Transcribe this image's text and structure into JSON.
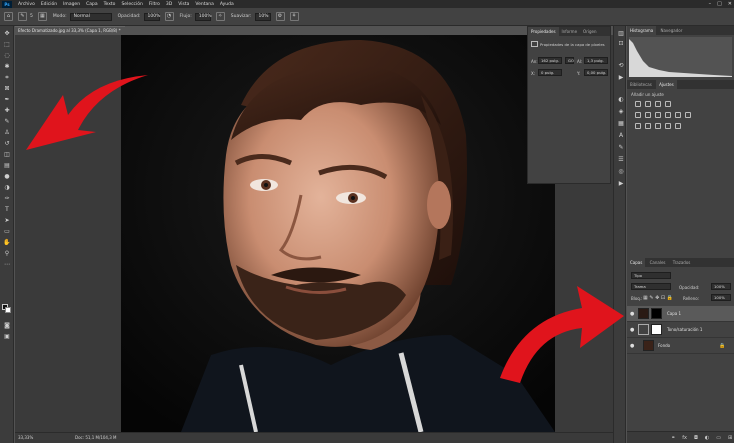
{
  "menubar": {
    "logo": "Ps",
    "items": [
      "Archivo",
      "Edición",
      "Imagen",
      "Capa",
      "Texto",
      "Selección",
      "Filtro",
      "3D",
      "Vista",
      "Ventana",
      "Ayuda"
    ],
    "window_controls": [
      "–",
      "□",
      "✕"
    ]
  },
  "options_bar": {
    "brush_size": "5",
    "mode_label": "Modo:",
    "mode_value": "Normal",
    "opacity_label": "Opacidad:",
    "opacity_value": "100%",
    "flow_label": "Flujo:",
    "flow_value": "100%",
    "smoothing_label": "Suavizar:",
    "smoothing_value": "10%"
  },
  "document": {
    "tab_title": "Efecto Dramatizado.jpg al 33,3% (Capa 1, RGB/8) *",
    "tab_close": "×"
  },
  "statusbar": {
    "zoom": "33,33%",
    "doc_info": "Doc: 51,1 M/104,3 M"
  },
  "properties_panel": {
    "tabs": [
      "Propiedades",
      "Informe",
      "Origen"
    ],
    "header": "Propiedades de la capa de píxeles",
    "an_label": "An:",
    "an_value": "162 pulg.",
    "go_label": "GO",
    "al_label": "Al:",
    "al_value": "1,3 pulg.",
    "x_label": "X:",
    "x_value": "0 pulg.",
    "y_label": "Y:",
    "y_value": "0,00 pulg."
  },
  "histogram_panel": {
    "tabs": [
      "Histograma",
      "Navegador"
    ]
  },
  "adjustments_panel": {
    "tabs": [
      "Bibliotecas",
      "Ajustes"
    ],
    "hint": "Añadir un ajuste"
  },
  "layers_panel": {
    "tabs": [
      "Capas",
      "Canales",
      "Trazados"
    ],
    "filter_value": "Tipo",
    "blend_mode": "Trama",
    "opacity_label": "Opacidad:",
    "opacity_value": "100%",
    "lock_label": "Bloq.:",
    "fill_label": "Relleno:",
    "fill_value": "100%",
    "layers": [
      {
        "name": "Capa 1",
        "selected": true
      },
      {
        "name": "Tono/saturación 1",
        "selected": false
      },
      {
        "name": "Fondo",
        "selected": false
      }
    ]
  },
  "annotation_colors": {
    "arrow": "#e0141c"
  }
}
